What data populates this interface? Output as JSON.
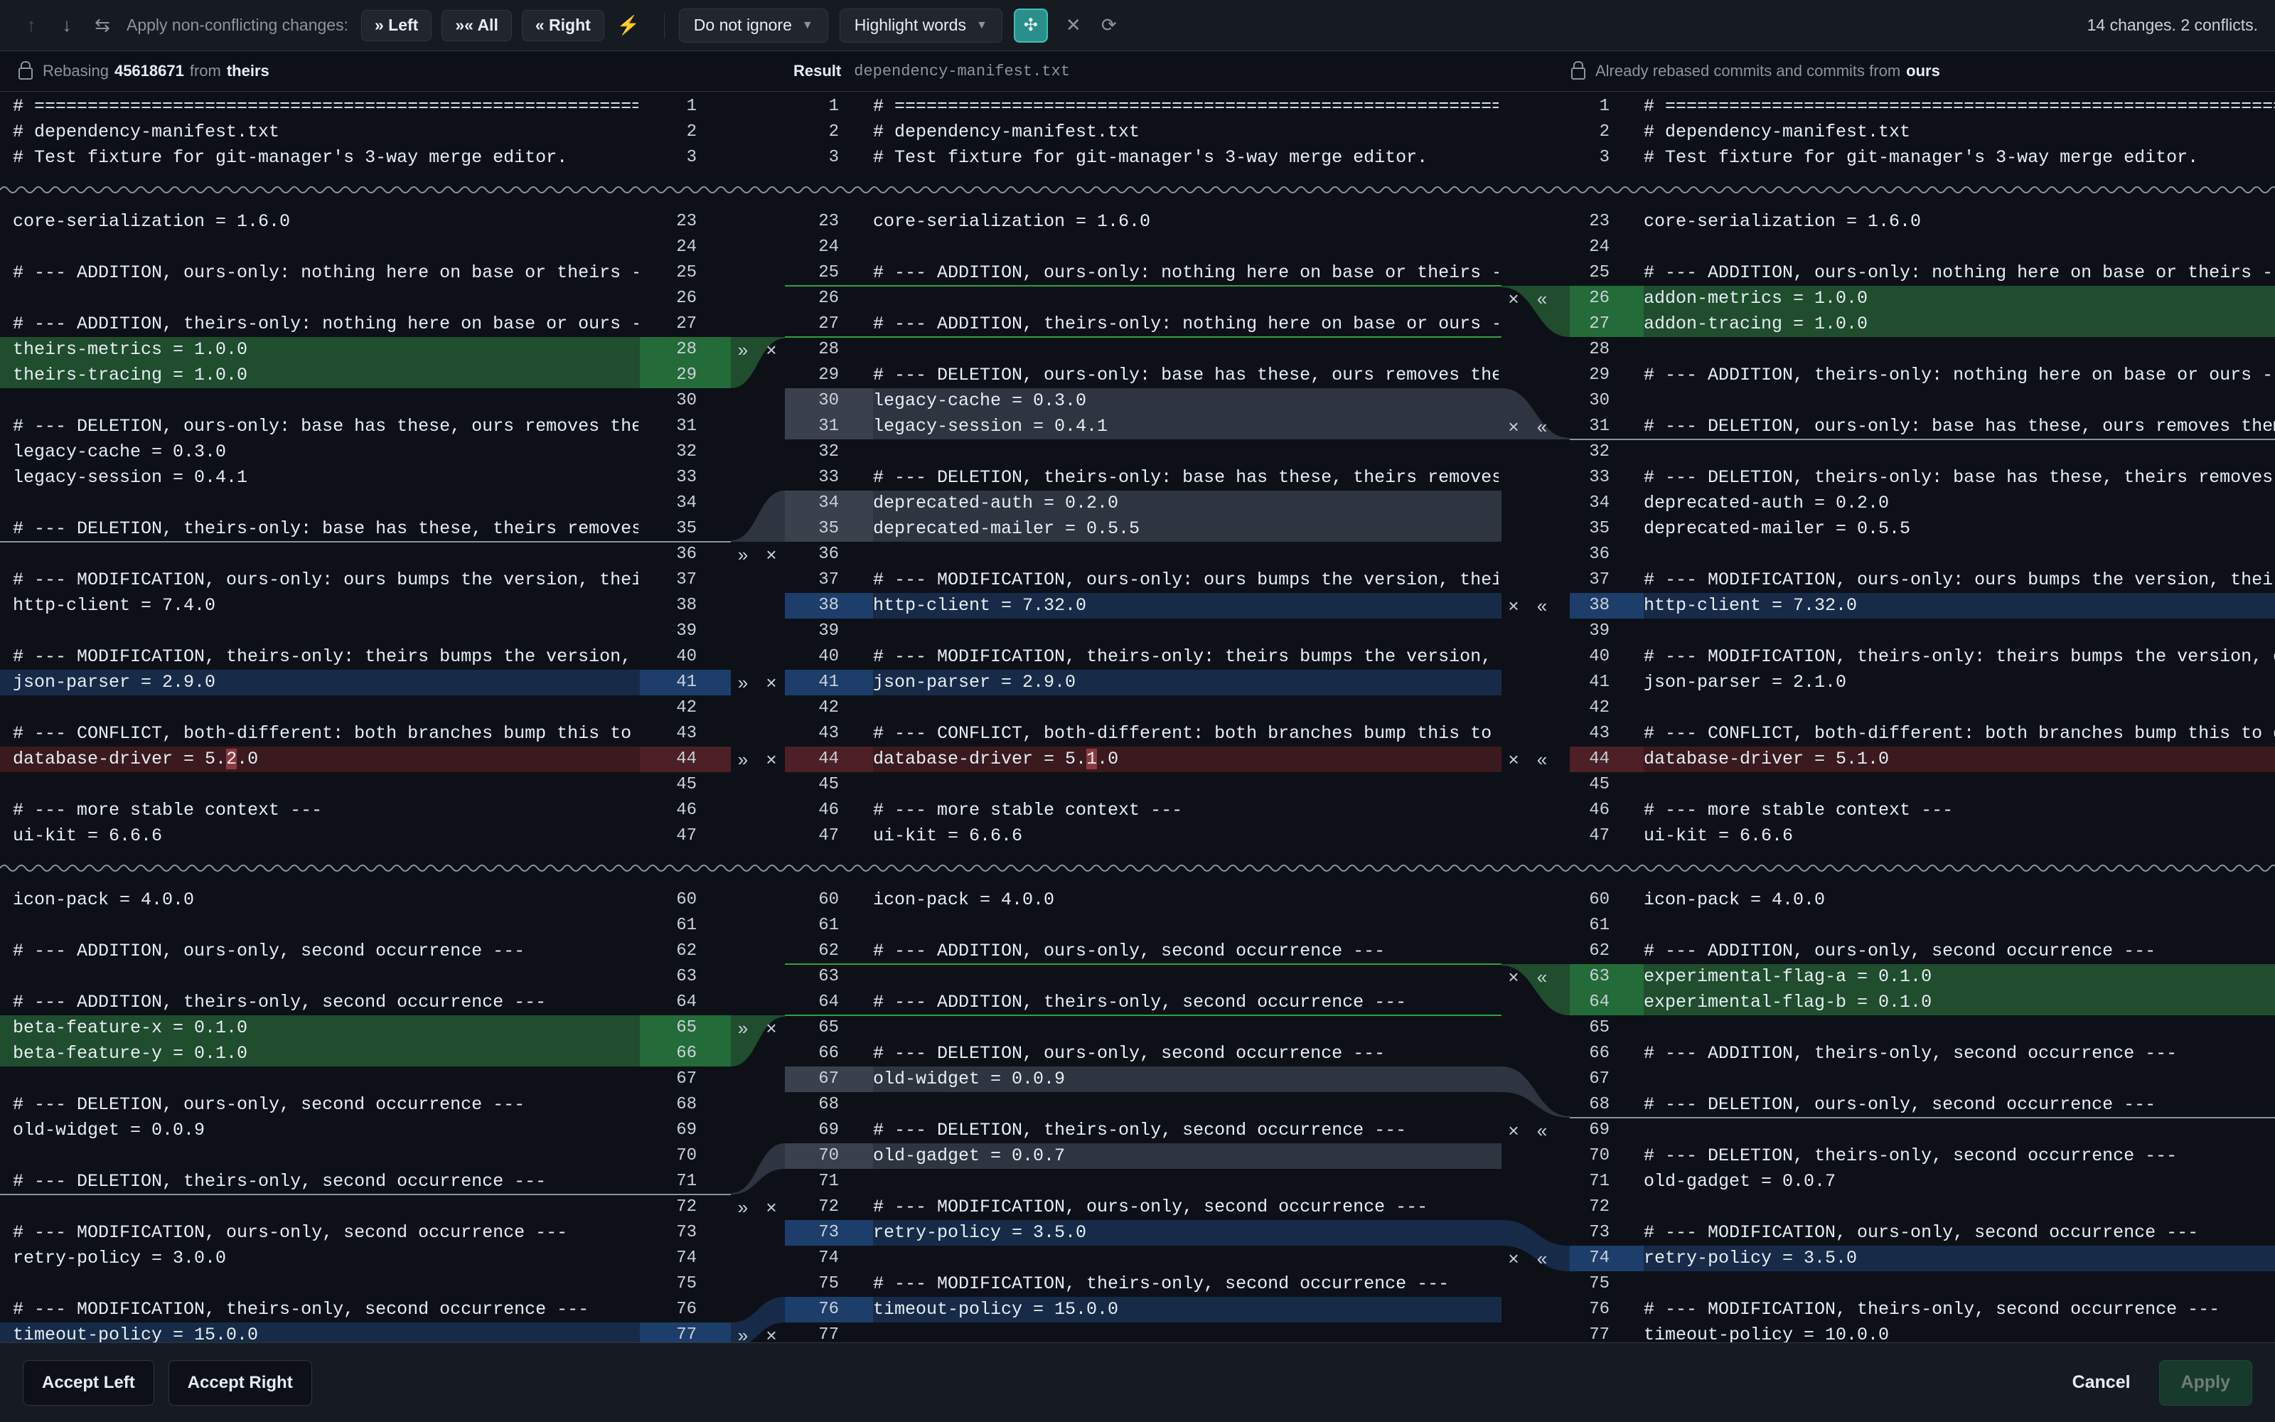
{
  "toolbar": {
    "apply_label": "Apply non-conflicting changes:",
    "left_label": "» Left",
    "all_label": "»« All",
    "right_label": "« Right",
    "ignore_value": "Do not ignore",
    "highlight_value": "Highlight words",
    "summary": "14 changes. 2 conflicts.",
    "icons": {
      "prev": "arrow-up-icon",
      "next": "arrow-down-icon",
      "apply": "apply-changes-icon",
      "magic": "magic-resolve-icon",
      "sync": "sync-scroll-icon",
      "close": "close-icon",
      "refresh": "refresh-icon"
    }
  },
  "header": {
    "left_prefix": "Rebasing",
    "left_hash": "45618671",
    "left_from": "from",
    "left_branch": "theirs",
    "result_label": "Result",
    "result_file": "dependency-manifest.txt",
    "right_text": "Already rebased commits and commits from",
    "right_branch": "ours"
  },
  "colors": {
    "addition": "#1f4d2e",
    "deletion": "#2e3440",
    "modification": "#172b48",
    "conflict": "#3a1a1f",
    "accent": "#2a8f8a"
  },
  "panes": {
    "left": [
      {
        "n": "1",
        "t": "# ========================================================================"
      },
      {
        "n": "2",
        "t": "# dependency-manifest.txt"
      },
      {
        "n": "3",
        "t": "# Test fixture for git-manager's 3-way merge editor."
      },
      {
        "gap": true
      },
      {
        "n": "23",
        "t": "core-serialization = 1.6.0"
      },
      {
        "n": "24",
        "t": ""
      },
      {
        "n": "25",
        "t": "# --- ADDITION, ours-only: nothing here on base or theirs ---"
      },
      {
        "n": "26",
        "t": ""
      },
      {
        "n": "27",
        "t": "# --- ADDITION, theirs-only: nothing here on base or ours ---"
      },
      {
        "n": "28",
        "t": "theirs-metrics = 1.0.0",
        "k": "add"
      },
      {
        "n": "29",
        "t": "theirs-tracing = 1.0.0",
        "k": "add"
      },
      {
        "n": "30",
        "t": ""
      },
      {
        "n": "31",
        "t": "# --- DELETION, ours-only: base has these, ours removes them, theirs keeps them ---"
      },
      {
        "n": "32",
        "t": "legacy-cache = 0.3.0"
      },
      {
        "n": "33",
        "t": "legacy-session = 0.4.1"
      },
      {
        "n": "34",
        "t": ""
      },
      {
        "n": "35",
        "t": "# --- DELETION, theirs-only: base has these, theirs removes them ---"
      },
      {
        "n": "36",
        "t": ""
      },
      {
        "n": "37",
        "t": "# --- MODIFICATION, ours-only: ours bumps the version, theirs keeps base ---"
      },
      {
        "n": "38",
        "t": "http-client = 7.4.0"
      },
      {
        "n": "39",
        "t": ""
      },
      {
        "n": "40",
        "t": "# --- MODIFICATION, theirs-only: theirs bumps the version, ours keeps base ---"
      },
      {
        "n": "41",
        "t": "json-parser = 2.9.0",
        "k": "mod"
      },
      {
        "n": "42",
        "t": ""
      },
      {
        "n": "43",
        "t": "# --- CONFLICT, both-different: both branches bump this to different versions ---"
      },
      {
        "n": "44",
        "k": "con",
        "parts": [
          "database-driver = 5.",
          "2",
          ".0"
        ]
      },
      {
        "n": "45",
        "t": ""
      },
      {
        "n": "46",
        "t": "# --- more stable context ---"
      },
      {
        "n": "47",
        "t": "ui-kit = 6.6.6"
      },
      {
        "gap": true
      },
      {
        "n": "60",
        "t": "icon-pack = 4.0.0"
      },
      {
        "n": "61",
        "t": ""
      },
      {
        "n": "62",
        "t": "# --- ADDITION, ours-only, second occurrence ---"
      },
      {
        "n": "63",
        "t": ""
      },
      {
        "n": "64",
        "t": "# --- ADDITION, theirs-only, second occurrence ---"
      },
      {
        "n": "65",
        "t": "beta-feature-x = 0.1.0",
        "k": "add"
      },
      {
        "n": "66",
        "t": "beta-feature-y = 0.1.0",
        "k": "add"
      },
      {
        "n": "67",
        "t": ""
      },
      {
        "n": "68",
        "t": "# --- DELETION, ours-only, second occurrence ---"
      },
      {
        "n": "69",
        "t": "old-widget = 0.0.9"
      },
      {
        "n": "70",
        "t": ""
      },
      {
        "n": "71",
        "t": "# --- DELETION, theirs-only, second occurrence ---"
      },
      {
        "n": "72",
        "t": ""
      },
      {
        "n": "73",
        "t": "# --- MODIFICATION, ours-only, second occurrence ---"
      },
      {
        "n": "74",
        "t": "retry-policy = 3.0.0"
      },
      {
        "n": "75",
        "t": ""
      },
      {
        "n": "76",
        "t": "# --- MODIFICATION, theirs-only, second occurrence ---"
      },
      {
        "n": "77",
        "t": "timeout-policy = 15.0.0",
        "k": "mod"
      }
    ],
    "result": [
      {
        "n": "1",
        "t": "# ========================================================================"
      },
      {
        "n": "2",
        "t": "# dependency-manifest.txt"
      },
      {
        "n": "3",
        "t": "# Test fixture for git-manager's 3-way merge editor."
      },
      {
        "gap": true
      },
      {
        "n": "23",
        "t": "core-serialization = 1.6.0"
      },
      {
        "n": "24",
        "t": ""
      },
      {
        "n": "25",
        "t": "# --- ADDITION, ours-only: nothing here on base or theirs ---"
      },
      {
        "n": "26",
        "t": ""
      },
      {
        "n": "27",
        "t": "# --- ADDITION, theirs-only: nothing here on base or ours ---"
      },
      {
        "n": "28",
        "t": ""
      },
      {
        "n": "29",
        "t": "# --- DELETION, ours-only: base has these, ours removes them, theirs keeps them ---"
      },
      {
        "n": "30",
        "t": "legacy-cache = 0.3.0",
        "k": "del"
      },
      {
        "n": "31",
        "t": "legacy-session = 0.4.1",
        "k": "del"
      },
      {
        "n": "32",
        "t": ""
      },
      {
        "n": "33",
        "t": "# --- DELETION, theirs-only: base has these, theirs removes them ---"
      },
      {
        "n": "34",
        "t": "deprecated-auth = 0.2.0",
        "k": "del"
      },
      {
        "n": "35",
        "t": "deprecated-mailer = 0.5.5",
        "k": "del"
      },
      {
        "n": "36",
        "t": ""
      },
      {
        "n": "37",
        "t": "# --- MODIFICATION, ours-only: ours bumps the version, theirs keeps base ---"
      },
      {
        "n": "38",
        "t": "http-client = 7.32.0",
        "k": "mod"
      },
      {
        "n": "39",
        "t": ""
      },
      {
        "n": "40",
        "t": "# --- MODIFICATION, theirs-only: theirs bumps the version, ours keeps base ---"
      },
      {
        "n": "41",
        "t": "json-parser = 2.9.0",
        "k": "mod"
      },
      {
        "n": "42",
        "t": ""
      },
      {
        "n": "43",
        "t": "# --- CONFLICT, both-different: both branches bump this to different versions ---"
      },
      {
        "n": "44",
        "k": "con",
        "parts": [
          "database-driver = 5.",
          "1",
          ".0"
        ]
      },
      {
        "n": "45",
        "t": ""
      },
      {
        "n": "46",
        "t": "# --- more stable context ---"
      },
      {
        "n": "47",
        "t": "ui-kit = 6.6.6"
      },
      {
        "gap": true
      },
      {
        "n": "60",
        "t": "icon-pack = 4.0.0"
      },
      {
        "n": "61",
        "t": ""
      },
      {
        "n": "62",
        "t": "# --- ADDITION, ours-only, second occurrence ---"
      },
      {
        "n": "63",
        "t": ""
      },
      {
        "n": "64",
        "t": "# --- ADDITION, theirs-only, second occurrence ---"
      },
      {
        "n": "65",
        "t": ""
      },
      {
        "n": "66",
        "t": "# --- DELETION, ours-only, second occurrence ---"
      },
      {
        "n": "67",
        "t": "old-widget = 0.0.9",
        "k": "del"
      },
      {
        "n": "68",
        "t": ""
      },
      {
        "n": "69",
        "t": "# --- DELETION, theirs-only, second occurrence ---"
      },
      {
        "n": "70",
        "t": "old-gadget = 0.0.7",
        "k": "del"
      },
      {
        "n": "71",
        "t": ""
      },
      {
        "n": "72",
        "t": "# --- MODIFICATION, ours-only, second occurrence ---"
      },
      {
        "n": "73",
        "t": "retry-policy = 3.5.0",
        "k": "mod"
      },
      {
        "n": "74",
        "t": ""
      },
      {
        "n": "75",
        "t": "# --- MODIFICATION, theirs-only, second occurrence ---"
      },
      {
        "n": "76",
        "t": "timeout-policy = 15.0.0",
        "k": "mod"
      },
      {
        "n": "77",
        "t": ""
      }
    ],
    "right": [
      {
        "n": "1",
        "t": "# ========================================================================"
      },
      {
        "n": "2",
        "t": "# dependency-manifest.txt"
      },
      {
        "n": "3",
        "t": "# Test fixture for git-manager's 3-way merge editor."
      },
      {
        "gap": true
      },
      {
        "n": "23",
        "t": "core-serialization = 1.6.0"
      },
      {
        "n": "24",
        "t": ""
      },
      {
        "n": "25",
        "t": "# --- ADDITION, ours-only: nothing here on base or theirs ---"
      },
      {
        "n": "26",
        "t": "addon-metrics = 1.0.0",
        "k": "add"
      },
      {
        "n": "27",
        "t": "addon-tracing = 1.0.0",
        "k": "add"
      },
      {
        "n": "28",
        "t": ""
      },
      {
        "n": "29",
        "t": "# --- ADDITION, theirs-only: nothing here on base or ours ---"
      },
      {
        "n": "30",
        "t": ""
      },
      {
        "n": "31",
        "t": "# --- DELETION, ours-only: base has these, ours removes them, theirs keeps them ---"
      },
      {
        "n": "32",
        "t": ""
      },
      {
        "n": "33",
        "t": "# --- DELETION, theirs-only: base has these, theirs removes them ---"
      },
      {
        "n": "34",
        "t": "deprecated-auth = 0.2.0"
      },
      {
        "n": "35",
        "t": "deprecated-mailer = 0.5.5"
      },
      {
        "n": "36",
        "t": ""
      },
      {
        "n": "37",
        "t": "# --- MODIFICATION, ours-only: ours bumps the version, theirs keeps base ---"
      },
      {
        "n": "38",
        "t": "http-client = 7.32.0",
        "k": "mod"
      },
      {
        "n": "39",
        "t": ""
      },
      {
        "n": "40",
        "t": "# --- MODIFICATION, theirs-only: theirs bumps the version, ours keeps base ---"
      },
      {
        "n": "41",
        "t": "json-parser = 2.1.0"
      },
      {
        "n": "42",
        "t": ""
      },
      {
        "n": "43",
        "t": "# --- CONFLICT, both-different: both branches bump this to different versions ---"
      },
      {
        "n": "44",
        "k": "con",
        "parts": [
          "database-driver = 5.1.0"
        ]
      },
      {
        "n": "45",
        "t": ""
      },
      {
        "n": "46",
        "t": "# --- more stable context ---"
      },
      {
        "n": "47",
        "t": "ui-kit = 6.6.6"
      },
      {
        "gap": true
      },
      {
        "n": "60",
        "t": "icon-pack = 4.0.0"
      },
      {
        "n": "61",
        "t": ""
      },
      {
        "n": "62",
        "t": "# --- ADDITION, ours-only, second occurrence ---"
      },
      {
        "n": "63",
        "t": "experimental-flag-a = 0.1.0",
        "k": "add"
      },
      {
        "n": "64",
        "t": "experimental-flag-b = 0.1.0",
        "k": "add"
      },
      {
        "n": "65",
        "t": ""
      },
      {
        "n": "66",
        "t": "# --- ADDITION, theirs-only, second occurrence ---"
      },
      {
        "n": "67",
        "t": ""
      },
      {
        "n": "68",
        "t": "# --- DELETION, ours-only, second occurrence ---"
      },
      {
        "n": "69",
        "t": ""
      },
      {
        "n": "70",
        "t": "# --- DELETION, theirs-only, second occurrence ---"
      },
      {
        "n": "71",
        "t": "old-gadget = 0.0.7"
      },
      {
        "n": "72",
        "t": ""
      },
      {
        "n": "73",
        "t": "# --- MODIFICATION, ours-only, second occurrence ---"
      },
      {
        "n": "74",
        "t": "retry-policy = 3.5.0",
        "k": "mod"
      },
      {
        "n": "75",
        "t": ""
      },
      {
        "n": "76",
        "t": "# --- MODIFICATION, theirs-only, second occurrence ---"
      },
      {
        "n": "77",
        "t": "timeout-policy = 10.0.0"
      }
    ]
  },
  "gutter_actions": {
    "left": {
      "apply": "»",
      "discard": "×"
    },
    "right": {
      "apply": "«",
      "discard": "×"
    }
  },
  "footer": {
    "accept_left": "Accept Left",
    "accept_right": "Accept Right",
    "cancel": "Cancel",
    "apply": "Apply"
  }
}
